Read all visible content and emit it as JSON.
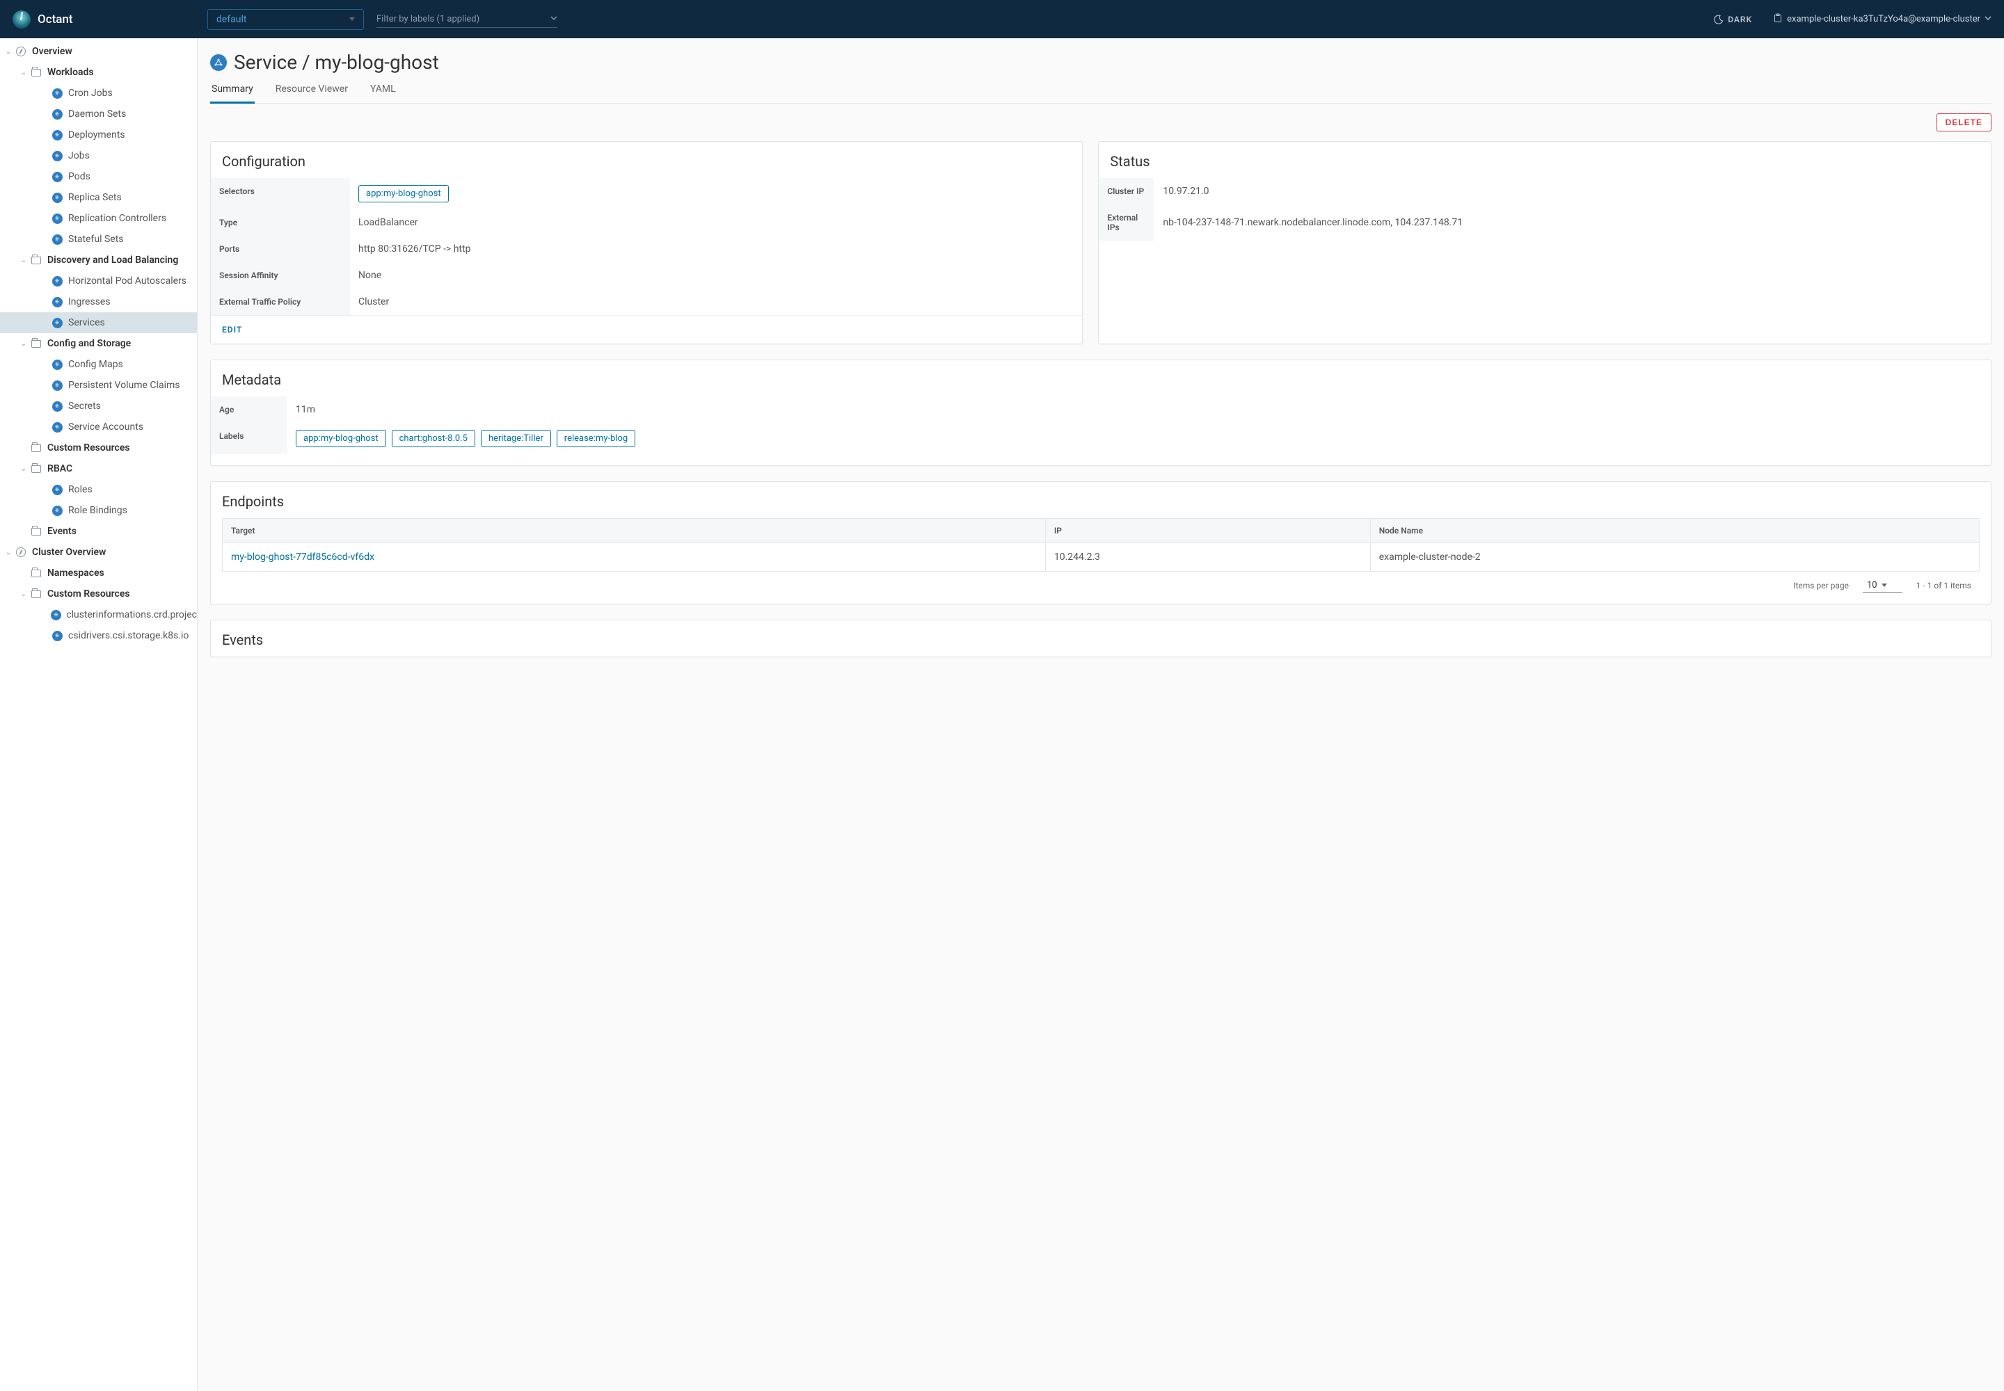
{
  "header": {
    "app_title": "Octant",
    "namespace": "default",
    "filter_label": "Filter by labels (1 applied)",
    "theme_label": "DARK",
    "context": "example-cluster-ka3TuTzYo4a@example-cluster"
  },
  "sidebar": {
    "overview": "Overview",
    "workloads": "Workloads",
    "workload_items": [
      "Cron Jobs",
      "Daemon Sets",
      "Deployments",
      "Jobs",
      "Pods",
      "Replica Sets",
      "Replication Controllers",
      "Stateful Sets"
    ],
    "discovery": "Discovery and Load Balancing",
    "discovery_items": [
      "Horizontal Pod Autoscalers",
      "Ingresses",
      "Services"
    ],
    "config": "Config and Storage",
    "config_items": [
      "Config Maps",
      "Persistent Volume Claims",
      "Secrets",
      "Service Accounts"
    ],
    "custom_resources": "Custom Resources",
    "rbac": "RBAC",
    "rbac_items": [
      "Roles",
      "Role Bindings"
    ],
    "events": "Events",
    "cluster_overview": "Cluster Overview",
    "namespaces": "Namespaces",
    "cluster_cr": "Custom Resources",
    "cluster_cr_items": [
      "clusterinformations.crd.projec",
      "csidrivers.csi.storage.k8s.io"
    ]
  },
  "page": {
    "title": "Service / my-blog-ghost",
    "tabs": [
      "Summary",
      "Resource Viewer",
      "YAML"
    ],
    "delete": "DELETE"
  },
  "configuration": {
    "title": "Configuration",
    "keys": {
      "selectors": "Selectors",
      "type": "Type",
      "ports": "Ports",
      "affinity": "Session Affinity",
      "policy": "External Traffic Policy"
    },
    "selector_chip": "app:my-blog-ghost",
    "type": "LoadBalancer",
    "ports": "http 80:31626/TCP -> http",
    "affinity": "None",
    "policy": "Cluster",
    "edit": "EDIT"
  },
  "status": {
    "title": "Status",
    "keys": {
      "cluster_ip": "Cluster IP",
      "external_ips": "External IPs"
    },
    "cluster_ip": "10.97.21.0",
    "external_ips": "nb-104-237-148-71.newark.nodebalancer.linode.com, 104.237.148.71"
  },
  "metadata": {
    "title": "Metadata",
    "keys": {
      "age": "Age",
      "labels": "Labels"
    },
    "age": "11m",
    "labels": [
      "app:my-blog-ghost",
      "chart:ghost-8.0.5",
      "heritage:Tiller",
      "release:my-blog"
    ]
  },
  "endpoints": {
    "title": "Endpoints",
    "headers": [
      "Target",
      "IP",
      "Node Name"
    ],
    "rows": [
      {
        "target": "my-blog-ghost-77df85c6cd-vf6dx",
        "ip": "10.244.2.3",
        "node": "example-cluster-node-2"
      }
    ],
    "items_per_page_label": "Items per page",
    "items_per_page": "10",
    "range": "1 - 1 of 1 items"
  },
  "events": {
    "title": "Events"
  }
}
